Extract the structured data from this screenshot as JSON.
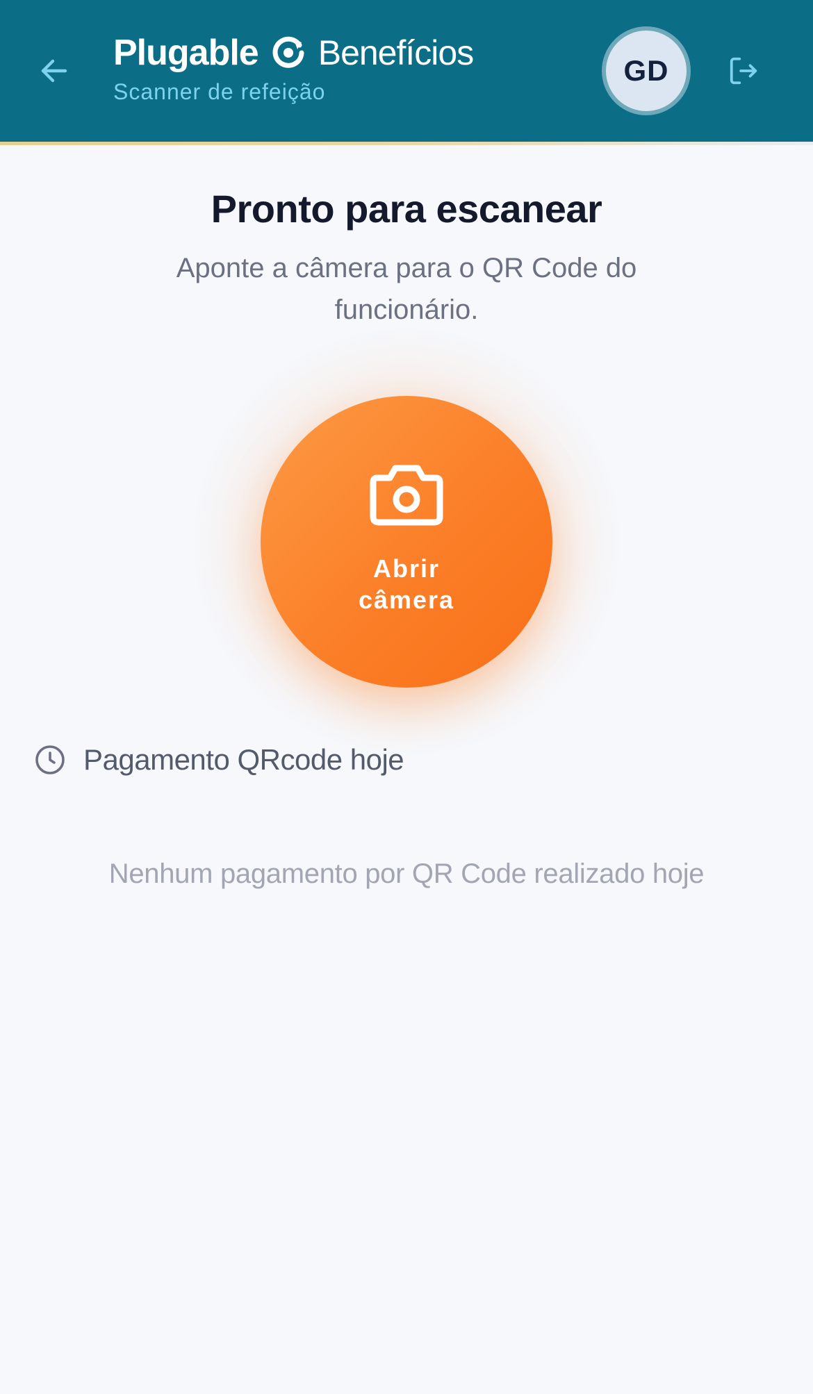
{
  "header": {
    "brand_strong": "Plugable",
    "brand_light": "Benefícios",
    "subtitle": "Scanner de refeição",
    "avatar_initials": "GD",
    "back_icon": "arrow-left-icon",
    "logout_icon": "logout-icon",
    "logo_icon": "plugable-logo-icon"
  },
  "main": {
    "title": "Pronto para escanear",
    "description": "Aponte a câmera para o QR Code do funcionário.",
    "camera_button": {
      "icon": "camera-icon",
      "label": "Abrir câmera"
    },
    "history": {
      "icon": "clock-icon",
      "label": "Pagamento QRcode hoje",
      "empty_text": "Nenhum pagamento por QR Code realizado hoje"
    }
  },
  "colors": {
    "header_bg": "#0b6e86",
    "accent_orange": "#fb7f28",
    "subtitle_cyan": "#7dd3ee",
    "page_bg": "#f6f8fc"
  }
}
